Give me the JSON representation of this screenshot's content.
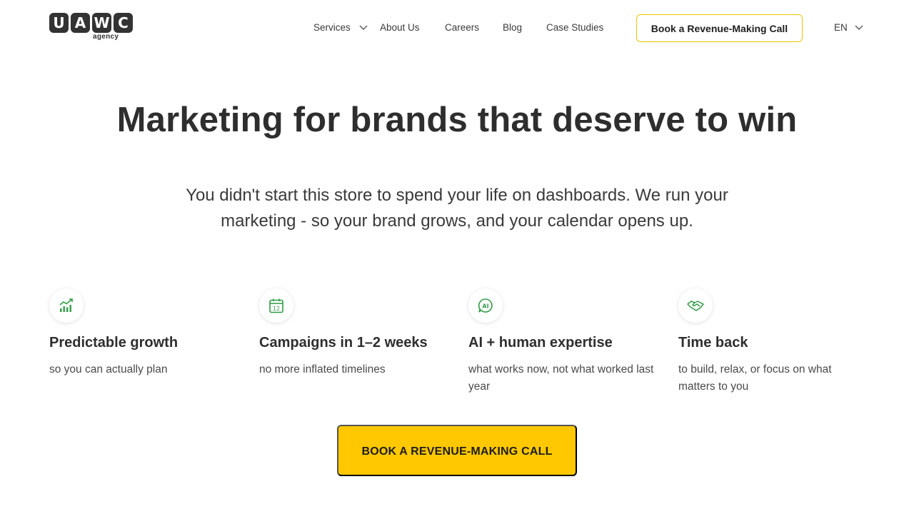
{
  "brand": {
    "logo_letters": [
      "U",
      "A",
      "W",
      "C"
    ],
    "logo_sub": "agency"
  },
  "nav": {
    "services": "Services",
    "about": "About Us",
    "careers": "Careers",
    "blog": "Blog",
    "case_studies": "Case Studies",
    "cta": "Book a Revenue-Making Call",
    "language": "EN"
  },
  "hero": {
    "title": "Marketing for brands that deserve to win",
    "subtitle": "You didn't start this store to spend your life on dashboards. We run your marketing - so your brand grows, and your calendar opens up."
  },
  "features": [
    {
      "icon": "growth-chart-icon",
      "title": "Predictable growth",
      "desc": "so you can actually plan"
    },
    {
      "icon": "calendar-icon",
      "title": "Campaigns in 1–2 weeks",
      "desc": "no more inflated timelines"
    },
    {
      "icon": "ai-chat-icon",
      "title": "AI + human expertise",
      "desc": "what works now, not what worked last year"
    },
    {
      "icon": "handshake-icon",
      "title": "Time back",
      "desc": "to build, relax, or focus on what matters to you"
    }
  ],
  "calendar_icon_number": "12",
  "ai_icon_text": "AI",
  "main_cta": "BOOK A REVENUE-MAKING CALL",
  "colors": {
    "accent_yellow": "#ffc800",
    "cta_border": "#f2c200",
    "icon_green": "#2f9e44",
    "text_dark": "#2e2e2e"
  }
}
